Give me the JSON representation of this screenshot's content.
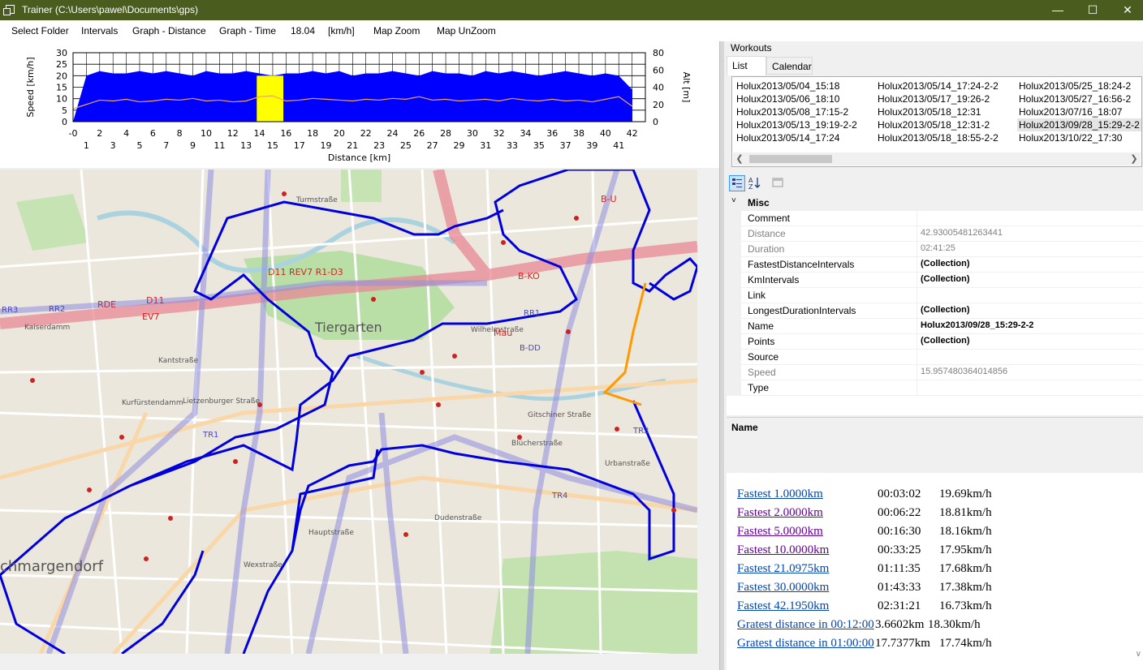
{
  "window": {
    "title": "Trainer (C:\\Users\\pawel\\Documents\\gps)",
    "minimize": "—",
    "maximize": "☐",
    "close": "✕"
  },
  "menu": [
    "Select Folder",
    "Intervals",
    "Graph - Distance",
    "Graph - Time",
    "18.04",
    "[km/h]",
    "Map Zoom",
    "Map UnZoom"
  ],
  "chart_data": {
    "type": "area",
    "xlabel": "Distance [km]",
    "ylabel": "Speed [km/h]",
    "y2label": "Alt [m]",
    "xlim": [
      0,
      43
    ],
    "ylim": [
      0,
      30
    ],
    "y2lim": [
      0,
      80
    ],
    "yticks": [
      0,
      5,
      10,
      15,
      20,
      25,
      30
    ],
    "y2ticks": [
      0,
      20,
      40,
      60,
      80
    ],
    "xticks_top": [
      "-0",
      "2",
      "4",
      "6",
      "8",
      "10",
      "12",
      "14",
      "16",
      "18",
      "20",
      "22",
      "24",
      "26",
      "28",
      "30",
      "32",
      "34",
      "36",
      "38",
      "40",
      "42"
    ],
    "xticks_bottom": [
      "1",
      "3",
      "5",
      "7",
      "9",
      "11",
      "13",
      "15",
      "17",
      "19",
      "21",
      "23",
      "25",
      "27",
      "29",
      "31",
      "33",
      "35",
      "37",
      "39",
      "41"
    ],
    "highlight_range_km": [
      13.8,
      15.8
    ],
    "series": [
      {
        "color": "#0000ff",
        "values": [
          0,
          20,
          22,
          21,
          21,
          22,
          21,
          22,
          21,
          20,
          22,
          21,
          21,
          22,
          21,
          20,
          21,
          21,
          22,
          21,
          22,
          20,
          21,
          21,
          22,
          21,
          20,
          22,
          21,
          21,
          20,
          22,
          21,
          22,
          21,
          20,
          21,
          22,
          21,
          20,
          21,
          20,
          14
        ]
      },
      {
        "color": "#f4a460",
        "values": [
          15,
          20,
          25,
          24,
          26,
          23,
          24,
          26,
          25,
          27,
          24,
          25,
          23,
          24,
          29,
          30,
          24,
          25,
          27,
          26,
          25,
          24,
          26,
          25,
          27,
          26,
          29,
          25,
          26,
          24,
          25,
          26,
          24,
          27,
          25,
          24,
          26,
          24,
          25,
          23,
          26,
          29,
          18
        ]
      }
    ]
  },
  "map": {
    "district_labels": [
      "Tiergarten",
      "chmargendorf"
    ],
    "street_labels": [
      "Turmstraße",
      "Kaiserdamm",
      "Kantstraße",
      "Kurfürstendamm",
      "Lietzenburger Straße",
      "Dudenstraße",
      "Hauptstraße",
      "Wexstraße",
      "Gitschiner Straße",
      "Blücherstraße",
      "Urbanstraße",
      "Wilhelmstraße",
      "Mau"
    ],
    "route_labels": [
      "RDE",
      "D11",
      "EV7",
      "RR2",
      "RR3",
      "RR1",
      "TR1",
      "TR4",
      "TR3",
      "R1",
      "B-KO",
      "B-U",
      "D11 REV7 R1-D3",
      "B-DD"
    ],
    "colors": {
      "route": "#0000dd",
      "fast_segment": "#ff9900",
      "rail": "#e86a78",
      "bike": "#7b7bdd"
    }
  },
  "workouts": {
    "label": "Workouts",
    "tabs": [
      "List",
      "Calendar"
    ],
    "items": [
      "Holux2013/05/04_15:18",
      "Holux2013/05/06_18:10",
      "Holux2013/05/08_17:15-2",
      "Holux2013/05/13_19:19-2-2",
      "Holux2013/05/14_17:24",
      "Holux2013/05/14_17:24-2-2",
      "Holux2013/05/17_19:26-2",
      "Holux2013/05/18_12:31",
      "Holux2013/05/18_12:31-2",
      "Holux2013/05/18_18:55-2-2",
      "Holux2013/05/25_18:24-2",
      "Holux2013/05/27_16:56-2",
      "Holux2013/07/16_18:07",
      "Holux2013/09/28_15:29-2-2",
      "Holux2013/10/22_17:30"
    ],
    "selected_index": 13
  },
  "properties": {
    "category": "Misc",
    "rows": [
      {
        "name": "Comment",
        "value": "",
        "readonly": false,
        "bold": false
      },
      {
        "name": "Distance",
        "value": "42.93005481263441",
        "readonly": true,
        "bold": false
      },
      {
        "name": "Duration",
        "value": "02:41:25",
        "readonly": true,
        "bold": false
      },
      {
        "name": "FastestDistanceIntervals",
        "value": "(Collection)",
        "readonly": false,
        "bold": true
      },
      {
        "name": "KmIntervals",
        "value": "(Collection)",
        "readonly": false,
        "bold": true
      },
      {
        "name": "Link",
        "value": "",
        "readonly": false,
        "bold": false
      },
      {
        "name": "LongestDurationIntervals",
        "value": "(Collection)",
        "readonly": false,
        "bold": true
      },
      {
        "name": "Name",
        "value": "Holux2013/09/28_15:29-2-2",
        "readonly": false,
        "bold": true
      },
      {
        "name": "Points",
        "value": "(Collection)",
        "readonly": false,
        "bold": true
      },
      {
        "name": "Source",
        "value": "",
        "readonly": false,
        "bold": false
      },
      {
        "name": "Speed",
        "value": "15.957480364014856",
        "readonly": true,
        "bold": false
      },
      {
        "name": "Type",
        "value": "",
        "readonly": false,
        "bold": false
      }
    ],
    "description_title": "Name"
  },
  "intervals": [
    {
      "label": "Fastest 1.0000km",
      "time": "00:03:02",
      "speed": "19.69km/h",
      "visited": false
    },
    {
      "label": "Fastest 2.0000km",
      "time": "00:06:22",
      "speed": "18.81km/h",
      "visited": true
    },
    {
      "label": "Fastest 5.0000km",
      "time": "00:16:30",
      "speed": "18.16km/h",
      "visited": true
    },
    {
      "label": "Fastest 10.0000km",
      "time": "00:33:25",
      "speed": "17.95km/h",
      "visited": true
    },
    {
      "label": "Fastest 21.0975km",
      "time": "01:11:35",
      "speed": "17.68km/h",
      "visited": false
    },
    {
      "label": "Fastest 30.0000km",
      "time": "01:43:33",
      "speed": "17.38km/h",
      "visited": false
    },
    {
      "label": "Fastest 42.1950km",
      "time": "02:31:21",
      "speed": "16.73km/h",
      "visited": false
    },
    {
      "label": "Gratest distance in 00:12:00",
      "time": "3.6602km",
      "speed": "18.30km/h",
      "visited": false
    },
    {
      "label": "Gratest distance in 01:00:00",
      "time": "17.7377km",
      "speed": "17.74km/h",
      "visited": false
    }
  ]
}
